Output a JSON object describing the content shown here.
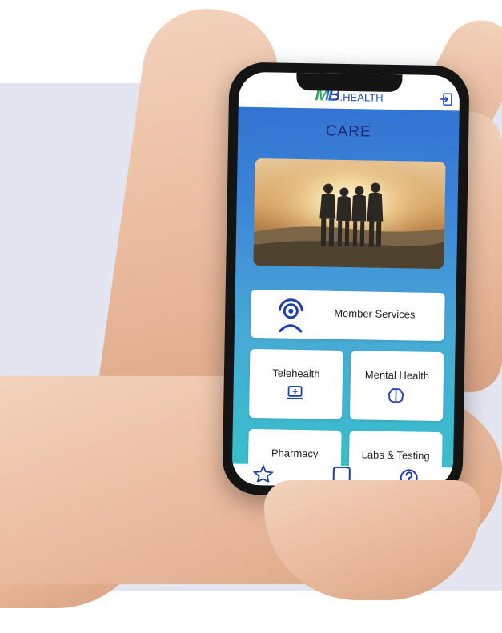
{
  "header": {
    "logo_mark": "MB",
    "logo_text": ".HEALTH"
  },
  "page": {
    "title": "CARE"
  },
  "cards": {
    "member_services": "Member Services",
    "telehealth": "Telehealth",
    "mental_health": "Mental Health",
    "pharmacy": "Pharmacy",
    "labs_testing": "Labs & Testing"
  },
  "icons": {
    "logout": "logout-icon",
    "member_services": "headset-person-icon",
    "telehealth": "laptop-medical-icon",
    "mental_health": "brain-icon",
    "nav_star": "star-icon",
    "nav_card": "id-card-icon",
    "nav_help": "question-icon"
  },
  "colors": {
    "brand_blue": "#1f4cc2",
    "brand_green": "#2f9f54",
    "title_navy": "#1e2a78",
    "gradient_top": "#2e6fd0",
    "gradient_bottom": "#35c3c9"
  }
}
